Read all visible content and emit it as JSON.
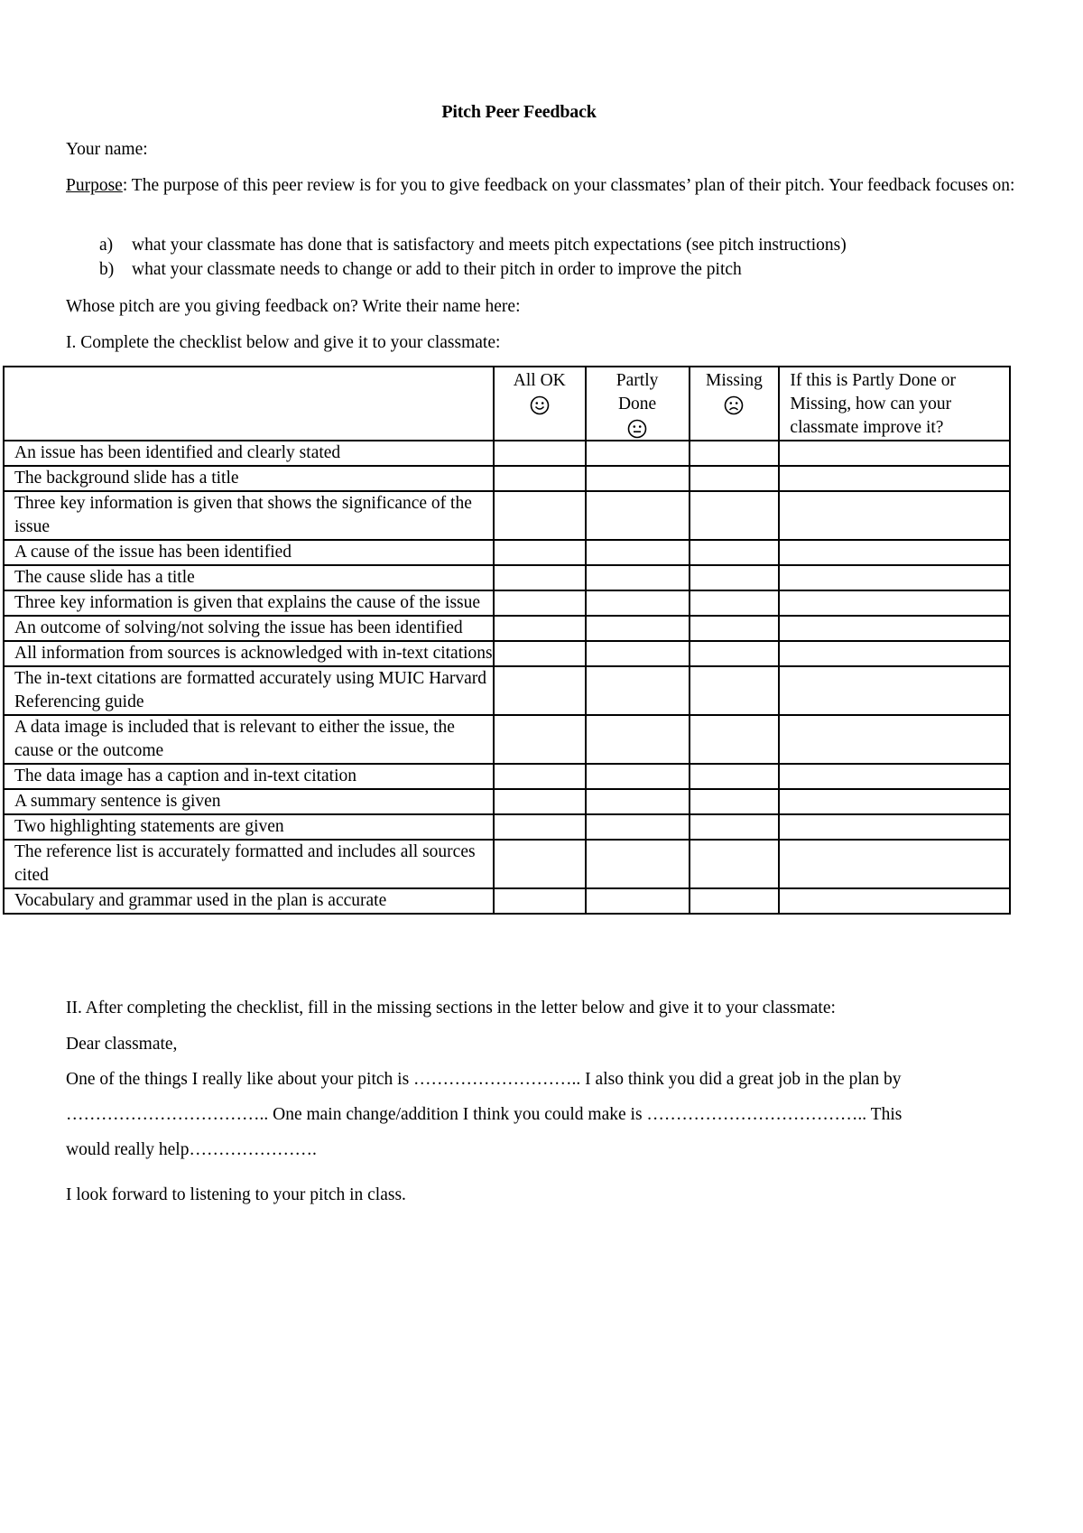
{
  "document": {
    "title": "Pitch Peer Feedback",
    "your_name_label": "Your name:",
    "purpose_label": "Purpose",
    "purpose_text": ": The purpose of this peer review is for you to give feedback on your classmates’ plan of their pitch. Your feedback focuses on:",
    "focus_points": [
      {
        "marker": "a)",
        "text": "what your classmate has done that is satisfactory and meets pitch expectations (see pitch instructions)"
      },
      {
        "marker": "b)",
        "text": "what your classmate needs to change or add to their pitch in order to improve the pitch"
      }
    ],
    "whose_pitch_label": "Whose pitch are you giving feedback on? Write their name here:",
    "section1_heading": "I. Complete the checklist below and give it to your classmate:"
  },
  "checklist": {
    "headers": {
      "item": "",
      "all_ok": "All OK",
      "all_ok_icon": "smiley-happy",
      "partly_line1": "Partly",
      "partly_line2": "Done",
      "partly_icon": "smiley-neutral",
      "missing": "Missing",
      "missing_icon": "smiley-sad",
      "improve": "If this is Partly Done or Missing, how can your classmate improve it?"
    },
    "rows": [
      "An issue has been identified and clearly stated",
      "The background slide has a title",
      "Three key information is given that shows the significance of the issue",
      "A cause of the issue has been identified",
      "The cause slide has a title",
      "Three key information is given that explains the cause of the issue",
      "An outcome of solving/not solving the issue has been identified",
      "All information from sources is acknowledged with in-text citations",
      "The in-text citations are formatted accurately using MUIC Harvard Referencing guide",
      "A data image is included that is relevant to either the issue, the cause or the outcome",
      "The data image has a caption and in-text citation",
      "A summary sentence is given",
      "Two highlighting statements are given",
      "The reference list is accurately formatted and includes all sources cited",
      "Vocabulary and grammar used in the plan is accurate"
    ]
  },
  "letter": {
    "section2_heading": "II. After completing the checklist, fill in the missing sections in the letter below and give it to your classmate:",
    "salutation": "Dear classmate,",
    "line1": "One of the things I really like about your pitch is ……………………….. I also think you did a great job in the plan by",
    "line2": "…………………………….. One main change/addition I think you could make is ……………………………….. This",
    "line3": "would really help………………….",
    "closing": "I look forward to listening to your pitch in class."
  }
}
